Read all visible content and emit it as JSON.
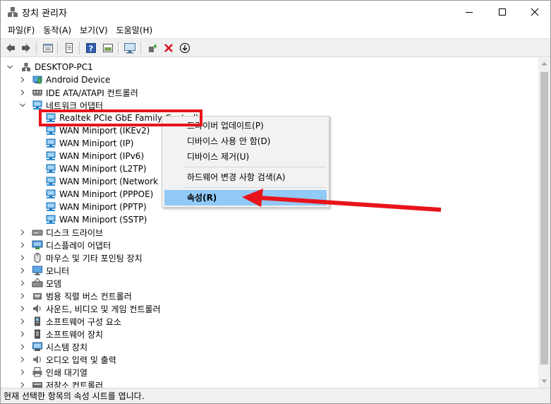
{
  "window": {
    "title": "장치 관리자",
    "controls": {
      "minimize": "minimize",
      "maximize": "maximize",
      "close": "close"
    }
  },
  "menubar": {
    "items": [
      {
        "label": "파일(F)"
      },
      {
        "label": "동작(A)"
      },
      {
        "label": "보기(V)"
      },
      {
        "label": "도움말(H)"
      }
    ]
  },
  "toolbar": {
    "buttons": [
      "back-arrow-icon",
      "forward-arrow-icon",
      "properties-grid-icon",
      "doc-icon",
      "help-icon",
      "panel-icon",
      "monitor-icon",
      "update-driver-icon",
      "uninstall-x-icon",
      "download-icon"
    ]
  },
  "tree": {
    "root": "DESKTOP-PC1",
    "nodes": [
      {
        "label": "Android Device",
        "level": 1,
        "state": "collapsed",
        "icon": "android-device-icon"
      },
      {
        "label": "IDE ATA/ATAPI 컨트롤러",
        "level": 1,
        "state": "collapsed",
        "icon": "ide-controller-icon"
      },
      {
        "label": "네트워크 어댑터",
        "level": 1,
        "state": "expanded",
        "icon": "network-adapter-icon"
      },
      {
        "label": "Realtek PCIe GbE Family Controller",
        "level": 2,
        "state": "leaf",
        "icon": "network-adapter-icon"
      },
      {
        "label": "WAN Miniport (IKEv2)",
        "level": 2,
        "state": "leaf",
        "icon": "network-adapter-icon"
      },
      {
        "label": "WAN Miniport (IP)",
        "level": 2,
        "state": "leaf",
        "icon": "network-adapter-icon"
      },
      {
        "label": "WAN Miniport (IPv6)",
        "level": 2,
        "state": "leaf",
        "icon": "network-adapter-icon"
      },
      {
        "label": "WAN Miniport (L2TP)",
        "level": 2,
        "state": "leaf",
        "icon": "network-adapter-icon"
      },
      {
        "label": "WAN Miniport (Network Monitor)",
        "level": 2,
        "state": "leaf",
        "icon": "network-adapter-icon"
      },
      {
        "label": "WAN Miniport (PPPOE)",
        "level": 2,
        "state": "leaf",
        "icon": "network-adapter-icon"
      },
      {
        "label": "WAN Miniport (PPTP)",
        "level": 2,
        "state": "leaf",
        "icon": "network-adapter-icon"
      },
      {
        "label": "WAN Miniport (SSTP)",
        "level": 2,
        "state": "leaf",
        "icon": "network-adapter-icon"
      },
      {
        "label": "디스크 드라이브",
        "level": 1,
        "state": "collapsed",
        "icon": "disk-drive-icon"
      },
      {
        "label": "디스플레이 어댑터",
        "level": 1,
        "state": "collapsed",
        "icon": "display-adapter-icon"
      },
      {
        "label": "마우스 및 기타 포인팅 장치",
        "level": 1,
        "state": "collapsed",
        "icon": "mouse-icon"
      },
      {
        "label": "모니터",
        "level": 1,
        "state": "collapsed",
        "icon": "monitor-icon"
      },
      {
        "label": "모뎀",
        "level": 1,
        "state": "collapsed",
        "icon": "modem-icon"
      },
      {
        "label": "범용 직렬 버스 컨트롤러",
        "level": 1,
        "state": "collapsed",
        "icon": "usb-controller-icon"
      },
      {
        "label": "사운드, 비디오 및 게임 컨트롤러",
        "level": 1,
        "state": "collapsed",
        "icon": "sound-icon"
      },
      {
        "label": "소프트웨어 구성 요소",
        "level": 1,
        "state": "collapsed",
        "icon": "software-component-icon"
      },
      {
        "label": "소프트웨어 장치",
        "level": 1,
        "state": "collapsed",
        "icon": "software-device-icon"
      },
      {
        "label": "시스템 장치",
        "level": 1,
        "state": "collapsed",
        "icon": "system-device-icon"
      },
      {
        "label": "오디오 입력 및 출력",
        "level": 1,
        "state": "collapsed",
        "icon": "audio-io-icon"
      },
      {
        "label": "인쇄 대기열",
        "level": 1,
        "state": "collapsed",
        "icon": "print-queue-icon"
      },
      {
        "label": "저장소 컨트롤러",
        "level": 1,
        "state": "collapsed",
        "icon": "storage-controller-icon"
      }
    ]
  },
  "context_menu": {
    "items": [
      {
        "label": "드라이버 업데이트(P)"
      },
      {
        "label": "디바이스 사용 안 함(D)"
      },
      {
        "label": "디바이스 제거(U)"
      },
      {
        "label": "하드웨어 변경 사항 검색(A)"
      },
      {
        "label": "속성(R)",
        "highlighted": true
      }
    ]
  },
  "annotation": {
    "highlight_color": "#e8141b"
  },
  "statusbar": {
    "text": "현재 선택한 항목의 속성 시트를 엽니다."
  },
  "colors": {
    "menu_highlight": "#91c9f7",
    "network_icon": "#2b8fd8"
  }
}
